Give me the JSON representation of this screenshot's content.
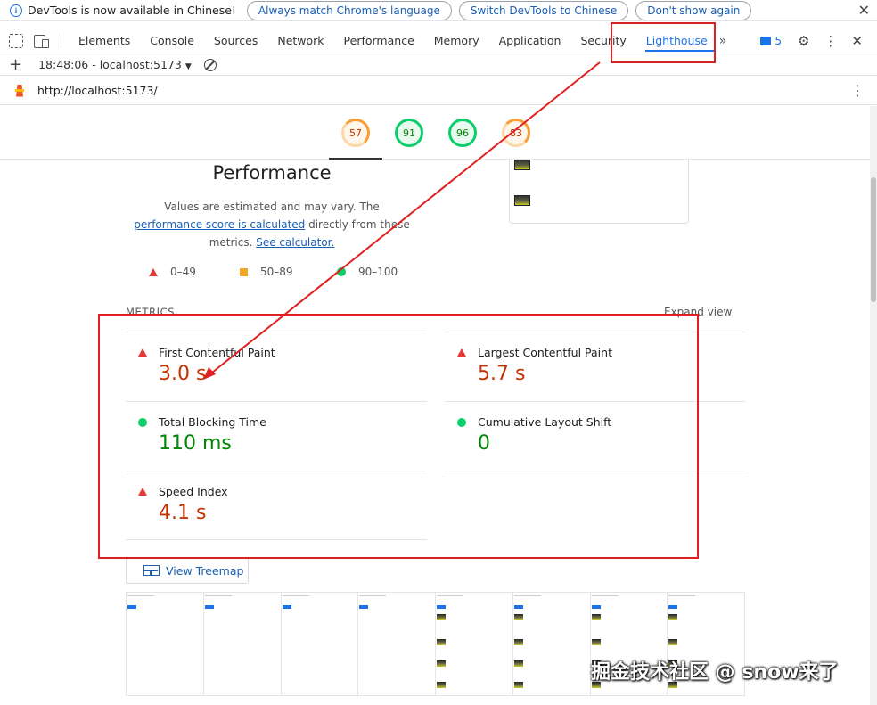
{
  "infobar": {
    "text": "DevTools is now available in Chinese!",
    "btn_match": "Always match Chrome's language",
    "btn_switch": "Switch DevTools to Chinese",
    "btn_dont_show": "Don't show again",
    "close": "✕"
  },
  "tabs": {
    "items": [
      "Elements",
      "Console",
      "Sources",
      "Network",
      "Performance",
      "Memory",
      "Application",
      "Security",
      "Lighthouse"
    ],
    "more": "»",
    "issues_count": "5"
  },
  "toolbar": {
    "report": "18:48:06 - localhost:5173"
  },
  "urlbar": {
    "url": "http://localhost:5173/"
  },
  "gauges": {
    "scores": [
      "57",
      "91",
      "96",
      "83"
    ]
  },
  "performance": {
    "title": "Performance",
    "desc_part1": "Values are estimated and may vary. The ",
    "desc_link1": "performance score is calculated",
    "desc_part2": " directly from these metrics. ",
    "desc_link2": "See calculator.",
    "legend_red": "0–49",
    "legend_orange": "50–89",
    "legend_green": "90–100"
  },
  "metrics": {
    "label": "METRICS",
    "expand": "Expand view",
    "fcp_name": "First Contentful Paint",
    "fcp_value": "3.0 s",
    "lcp_name": "Largest Contentful Paint",
    "lcp_value": "5.7 s",
    "tbt_name": "Total Blocking Time",
    "tbt_value": "110 ms",
    "cls_name": "Cumulative Layout Shift",
    "cls_value": "0",
    "si_name": "Speed Index",
    "si_value": "4.1 s"
  },
  "treemap": {
    "label": "View Treemap"
  },
  "watermark": "掘金技术社区 @ snow来了",
  "colors": {
    "accent": "#1a73e8",
    "fail": "#c33300",
    "pass": "#008800",
    "average": "#fa9e38",
    "annotation": "#e02020"
  }
}
